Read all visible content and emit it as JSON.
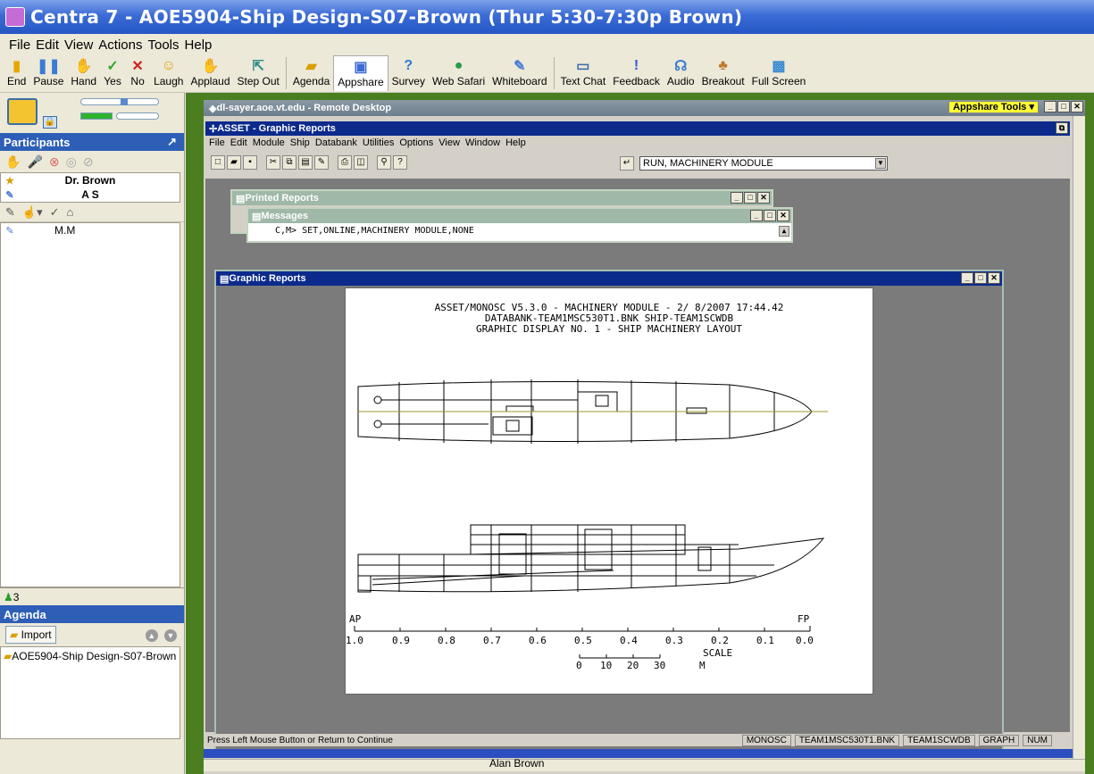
{
  "window": {
    "title": "Centra 7 - AOE5904-Ship Design-S07-Brown (Thur 5:30-7:30p Brown)"
  },
  "menubar": [
    "File",
    "Edit",
    "View",
    "Actions",
    "Tools",
    "Help"
  ],
  "toolbar": [
    {
      "label": "End",
      "icon": "end-icon"
    },
    {
      "label": "Pause",
      "icon": "pause-icon"
    },
    {
      "label": "Hand",
      "icon": "hand-icon"
    },
    {
      "label": "Yes",
      "icon": "check-icon"
    },
    {
      "label": "No",
      "icon": "x-icon"
    },
    {
      "label": "Laugh",
      "icon": "laugh-icon"
    },
    {
      "label": "Applaud",
      "icon": "applaud-icon"
    },
    {
      "label": "Step Out",
      "icon": "step-out-icon"
    },
    {
      "label": "Agenda",
      "icon": "agenda-icon"
    },
    {
      "label": "Appshare",
      "icon": "appshare-icon"
    },
    {
      "label": "Survey",
      "icon": "survey-icon"
    },
    {
      "label": "Web Safari",
      "icon": "globe-icon"
    },
    {
      "label": "Whiteboard",
      "icon": "whiteboard-icon"
    },
    {
      "label": "Text Chat",
      "icon": "chat-icon"
    },
    {
      "label": "Feedback",
      "icon": "feedback-icon"
    },
    {
      "label": "Audio",
      "icon": "audio-icon"
    },
    {
      "label": "Breakout",
      "icon": "breakout-icon"
    },
    {
      "label": "Full Screen",
      "icon": "fullscreen-icon"
    }
  ],
  "participants": {
    "heading": "Participants",
    "rows": [
      "Dr. Brown",
      "A        S"
    ],
    "others": [
      "M.M"
    ],
    "count": "3"
  },
  "agenda": {
    "heading": "Agenda",
    "import_label": "Import",
    "items": [
      "AOE5904-Ship Design-S07-Brown"
    ]
  },
  "remote": {
    "title": "dl-sayer.aoe.vt.edu - Remote Desktop",
    "appshare_tools": "Appshare Tools",
    "asset_title": "ASSET - Graphic Reports",
    "asset_menu": [
      "File",
      "Edit",
      "Module",
      "Ship",
      "Databank",
      "Utilities",
      "Options",
      "View",
      "Window",
      "Help"
    ],
    "command": "RUN, MACHINERY MODULE",
    "printed_reports": "Printed Reports",
    "messages": "Messages",
    "message_line": "C,M> SET,ONLINE,MACHINERY MODULE,NONE",
    "graphic_reports": "Graphic Reports",
    "report_header": [
      "ASSET/MONOSC V5.3.0 - MACHINERY MODULE -  2/ 8/2007 17:44.42",
      "DATABANK-TEAM1MSC530T1.BNK   SHIP-TEAM1SCWDB",
      "GRAPHIC DISPLAY NO. 1 - SHIP MACHINERY LAYOUT"
    ],
    "ap_label": "AP",
    "fp_label": "FP",
    "axis_ticks": [
      "1.0",
      "0.9",
      "0.8",
      "0.7",
      "0.6",
      "0.5",
      "0.4",
      "0.3",
      "0.2",
      "0.1",
      "0.0"
    ],
    "scale_label": "SCALE",
    "scale_ticks": [
      "0",
      "10",
      "20",
      "30"
    ],
    "scale_unit": "M",
    "status_left": "Press Left Mouse Button or Return to Continue",
    "status_cells": [
      "MONOSC",
      "TEAM1MSC530T1.BNK",
      "TEAM1SCWDB",
      "GRAPH",
      "NUM"
    ],
    "presenter": "Alan Brown"
  }
}
